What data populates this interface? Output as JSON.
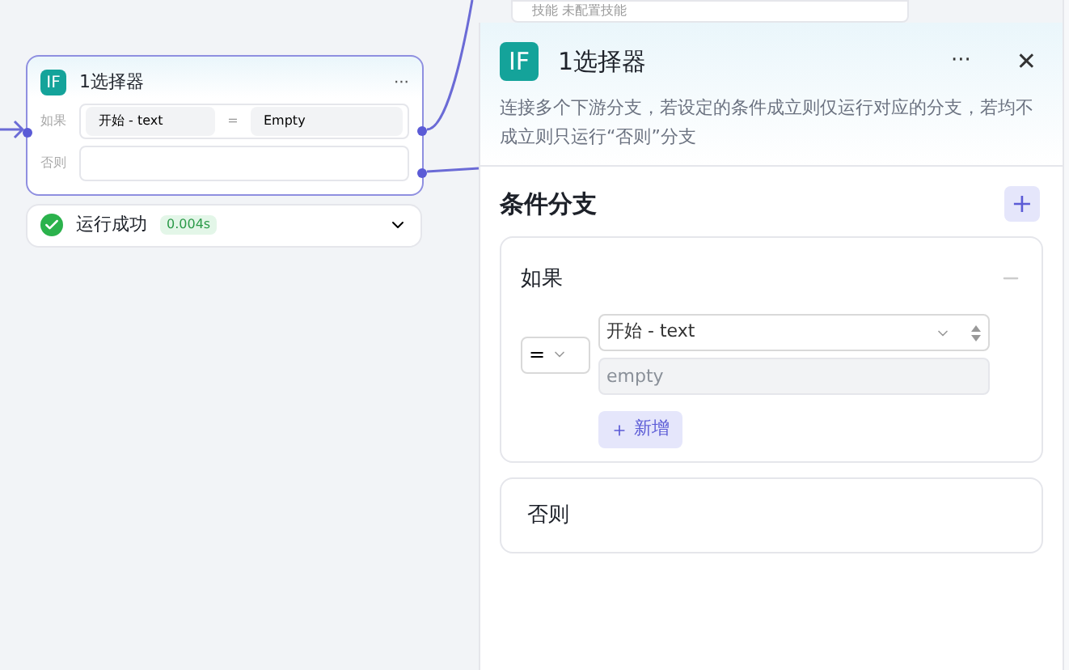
{
  "background_node": {
    "text": "技能 未配置技能"
  },
  "node": {
    "badge": "IF",
    "title": "1选择器",
    "menu": "···",
    "branches": [
      {
        "label": "如果",
        "left": "开始 - text",
        "operator": "=",
        "right": "Empty"
      },
      {
        "label": "否则"
      }
    ]
  },
  "run_status": {
    "label": "运行成功",
    "time": "0.004s",
    "expanded": false
  },
  "panel": {
    "badge": "IF",
    "title": "1选择器",
    "menu": "···",
    "close": "✕",
    "description": "连接多个下游分支，若设定的条件成立则仅运行对应的分支，若均不成立则只运行“否则”分支",
    "section_title": "条件分支",
    "add": "+",
    "if_block": {
      "title": "如果",
      "operator": "=",
      "variable": "开始 - text",
      "value_placeholder": "empty",
      "add_label": "新增"
    },
    "else_block": {
      "title": "否则"
    }
  }
}
